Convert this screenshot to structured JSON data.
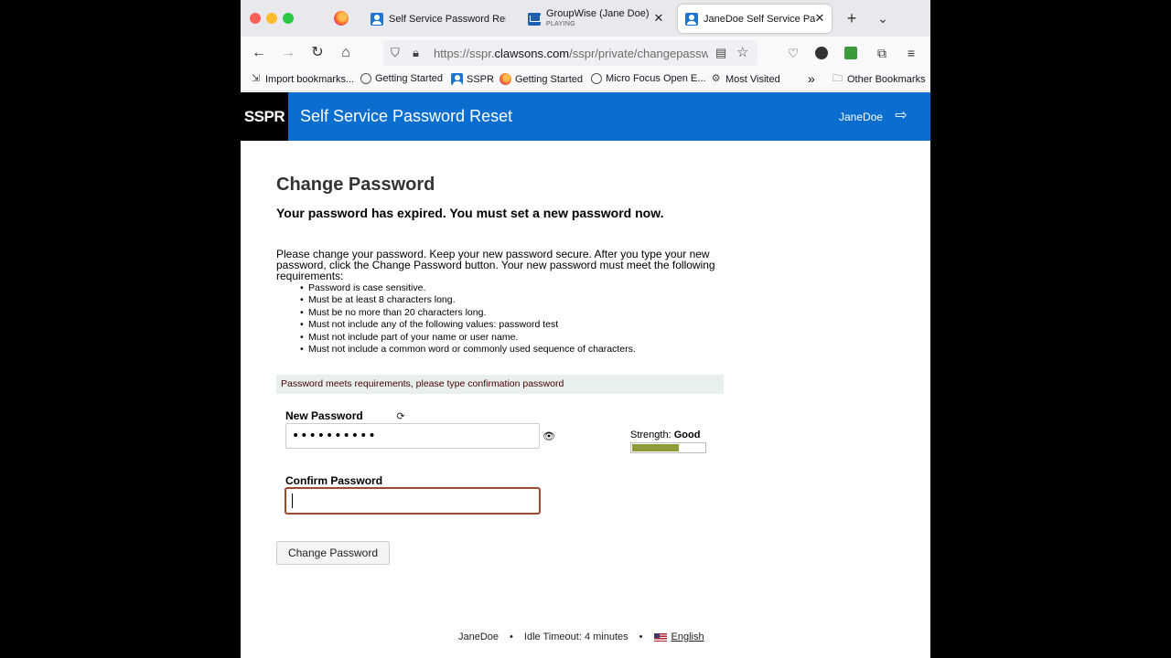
{
  "browser": {
    "tabs": [
      {
        "title": "Self Service Password Reset",
        "active": false
      },
      {
        "title": "GroupWise (Jane Doe)",
        "subtitle": "PLAYING",
        "active": false
      },
      {
        "title": "JaneDoe Self Service Password Reset",
        "active": true
      }
    ],
    "url": {
      "prefix": "https://sspr.",
      "domain": "clawsons.com",
      "path": "/sspr/private/changepassword"
    },
    "bookmarks": [
      {
        "label": "Import bookmarks...",
        "icon": "import-icon"
      },
      {
        "label": "Getting Started",
        "icon": "globe-icon"
      },
      {
        "label": "SSPR",
        "icon": "sspr-icon"
      },
      {
        "label": "Getting Started",
        "icon": "firefox-icon"
      },
      {
        "label": "Micro Focus Open E...",
        "icon": "globe-icon"
      },
      {
        "label": "Most Visited",
        "icon": "gear-icon"
      }
    ],
    "other_bookmarks": "Other Bookmarks"
  },
  "header": {
    "logo": "SSPR",
    "title": "Self Service Password Reset",
    "user": "JaneDoe"
  },
  "main": {
    "title": "Change Password",
    "expired_message": "Your password has expired. You must set a new password now.",
    "intro": "Please change your password. Keep your new password secure. After you type your new password, click the Change Password button. Your new password must meet the following requirements:",
    "requirements": [
      "Password is case sensitive.",
      "Must be at least 8 characters long.",
      "Must be no more than 20 characters long.",
      "Must not include any of the following values: password test",
      "Must not include part of your name or user name.",
      "Must not include a common word or commonly used sequence of characters."
    ],
    "status_message": "Password meets requirements, please type confirmation password",
    "new_password_label": "New Password",
    "new_password_value": "••••••••••",
    "strength_label": "Strength:",
    "strength_value": "Good",
    "strength_level": 0.65,
    "confirm_password_label": "Confirm Password",
    "confirm_password_value": "",
    "change_button": "Change Password"
  },
  "footer": {
    "user": "JaneDoe",
    "idle_timeout": "Idle Timeout: 4 minutes",
    "language": "English"
  },
  "colors": {
    "header_blue": "#0a6ed1",
    "strength_fill": "#8f9a3a",
    "confirm_border": "#a2482d",
    "status_bg": "#e8f0ec"
  }
}
